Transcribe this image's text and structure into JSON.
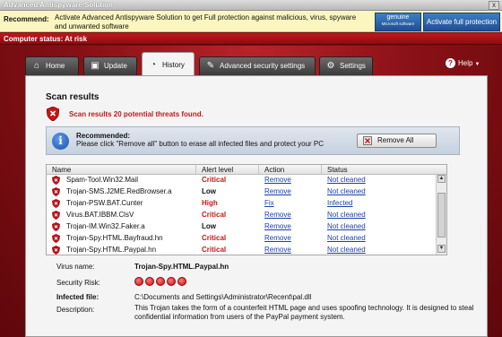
{
  "window": {
    "title": "Advanced Antispyware Solution",
    "close_glyph": "x"
  },
  "recommend_bar": {
    "label": "Recommend:",
    "message": "Activate Advanced Antispyware Solution to get Full protection against malicious, virus, spyware and unwanted software",
    "genuine_line1": "genuine",
    "genuine_line2": "Microsoft software",
    "activate_button": "Activate full protection"
  },
  "status_bar": {
    "text": "Computer status: At risk"
  },
  "tabs": [
    {
      "label": "Home",
      "icon": "home-icon"
    },
    {
      "label": "Update",
      "icon": "update-icon"
    },
    {
      "label": "History",
      "icon": "history-icon",
      "active": true
    },
    {
      "label": "Advanced security settings",
      "icon": "wrench-icon"
    },
    {
      "label": "Settings",
      "icon": "gear-icon"
    }
  ],
  "help": {
    "label": "Help"
  },
  "scan": {
    "title": "Scan results",
    "result_text": "Scan results 20 potential threats found.",
    "recommended_title": "Recommended:",
    "recommended_text": "Please click \"Remove all\" button to erase all infected files and protect your PC",
    "remove_all_button": "Remove All"
  },
  "table": {
    "columns": [
      "Name",
      "Alert level",
      "Action",
      "Status"
    ],
    "rows": [
      {
        "name": "Spam-Tool.Win32.Mail",
        "level": "Critical",
        "action": "Remove",
        "status": "Not cleaned"
      },
      {
        "name": "Trojan-SMS.J2ME.RedBrowser.a",
        "level": "Low",
        "action": "Remove",
        "status": "Not cleaned"
      },
      {
        "name": "Trojan-PSW.BAT.Cunter",
        "level": "High",
        "action": "Fix",
        "status": "Infected"
      },
      {
        "name": "Virus.BAT.IBBM.ClsV",
        "level": "Critical",
        "action": "Remove",
        "status": "Not cleaned"
      },
      {
        "name": "Trojan-IM.Win32.Faker.a",
        "level": "Low",
        "action": "Remove",
        "status": "Not cleaned"
      },
      {
        "name": "Trojan-Spy.HTML.Bayfraud.hn",
        "level": "Critical",
        "action": "Remove",
        "status": "Not cleaned"
      },
      {
        "name": "Trojan-Spy.HTML.Paypal.hn",
        "level": "Critical",
        "action": "Remove",
        "status": "Not cleaned"
      }
    ]
  },
  "details": {
    "virus_name_label": "Virus name:",
    "virus_name": "Trojan-Spy.HTML.Paypal.hn",
    "risk_label": "Security Risk:",
    "risk_level": 5,
    "infected_label": "Infected file:",
    "infected_file": "C:\\Documents and Settings\\Administrator\\Recent\\pal.dll",
    "description_label": "Description:",
    "description": "This Trojan takes the form of a counterfeit HTML page and uses spoofing technology. It is designed to steal confidential information from users of the PayPal payment system."
  },
  "colors": {
    "critical": "#c41818",
    "high": "#c41818",
    "low": "#111111",
    "link": "#1a3fa8"
  }
}
